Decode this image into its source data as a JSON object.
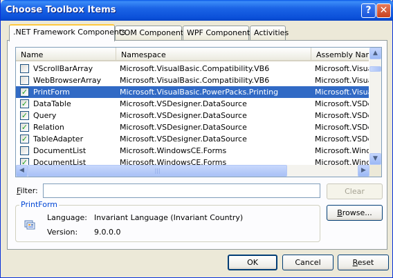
{
  "window": {
    "title": "Choose Toolbox Items",
    "help_glyph": "?",
    "close_glyph": "✕"
  },
  "tabs": [
    {
      "label": ".NET Framework Components",
      "active": true
    },
    {
      "label": "COM Components",
      "active": false
    },
    {
      "label": "WPF Components",
      "active": false
    },
    {
      "label": "Activities",
      "active": false
    }
  ],
  "list": {
    "columns": [
      "Name",
      "Namespace",
      "Assembly Name"
    ],
    "rows": [
      {
        "checked": false,
        "name": "VScrollBarArray",
        "namespace": "Microsoft.VisualBasic.Compatibility.VB6",
        "assembly": "Microsoft.VisualB",
        "selected": false
      },
      {
        "checked": false,
        "name": "WebBrowserArray",
        "namespace": "Microsoft.VisualBasic.Compatibility.VB6",
        "assembly": "Microsoft.VisualB",
        "selected": false
      },
      {
        "checked": true,
        "name": "PrintForm",
        "namespace": "Microsoft.VisualBasic.PowerPacks.Printing",
        "assembly": "Microsoft.VisualB",
        "selected": true
      },
      {
        "checked": true,
        "name": "DataTable",
        "namespace": "Microsoft.VSDesigner.DataSource",
        "assembly": "Microsoft.VSDes",
        "selected": false
      },
      {
        "checked": true,
        "name": "Query",
        "namespace": "Microsoft.VSDesigner.DataSource",
        "assembly": "Microsoft.VSDes",
        "selected": false
      },
      {
        "checked": true,
        "name": "Relation",
        "namespace": "Microsoft.VSDesigner.DataSource",
        "assembly": "Microsoft.VSDes",
        "selected": false
      },
      {
        "checked": true,
        "name": "TableAdapter",
        "namespace": "Microsoft.VSDesigner.DataSource",
        "assembly": "Microsoft.VSDes",
        "selected": false
      },
      {
        "checked": false,
        "name": "DocumentList",
        "namespace": "Microsoft.WindowsCE.Forms",
        "assembly": "Microsoft.Windo",
        "selected": false
      },
      {
        "checked": true,
        "name": "DocumentList",
        "namespace": "Microsoft.WindowsCE.Forms",
        "assembly": "Microsoft.Windo",
        "selected": false
      }
    ]
  },
  "filter": {
    "label_prefix": "F",
    "label_rest": "ilter:",
    "value": ""
  },
  "buttons": {
    "clear": "Clear",
    "browse_u": "B",
    "browse_rest": "rowse...",
    "ok": "OK",
    "cancel": "Cancel",
    "reset_u": "R",
    "reset_rest": "eset"
  },
  "details": {
    "group_title": "PrintForm",
    "language_label": "Language:",
    "language_value": "Invariant Language (Invariant Country)",
    "version_label": "Version:",
    "version_value": "9.0.0.0"
  },
  "colors": {
    "title_bar": "#0a4fd8",
    "selection": "#316ac5",
    "check": "#21a121",
    "tab_highlight": "#ffc83c"
  },
  "icons": {
    "check": "✓",
    "scroll_up": "▲",
    "scroll_down": "▼",
    "scroll_left": "◀",
    "scroll_right": "▶"
  }
}
